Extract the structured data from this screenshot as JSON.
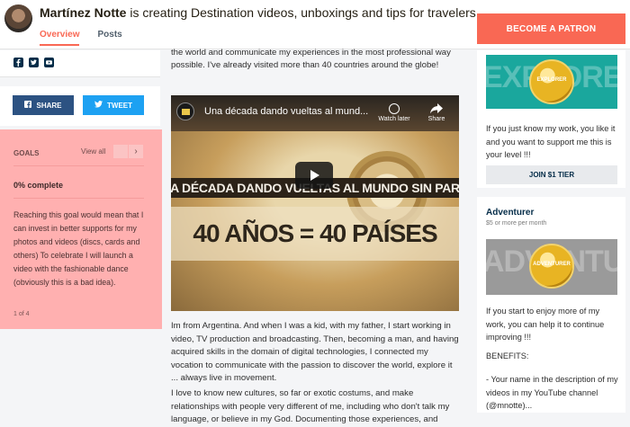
{
  "header": {
    "creator_name": "Martínez Notte",
    "tagline": " is creating Destination videos, unboxings and tips for travelers.",
    "tabs": [
      {
        "label": "Overview",
        "active": true
      },
      {
        "label": "Posts",
        "active": false
      }
    ],
    "become_patron_label": "BECOME A PATRON",
    "accent_color": "#f96854"
  },
  "social": {
    "icons": [
      "facebook-icon",
      "twitter-icon",
      "youtube-icon"
    ],
    "share_label": "SHARE",
    "tweet_label": "TWEET"
  },
  "goals": {
    "title": "GOALS",
    "view_all": "View all",
    "next_glyph": "›",
    "complete": "0% complete",
    "description": "Reaching this goal would mean that I can invest in better supports for my photos and videos (discs, cards and others) To celebrate I will launch a video with the fashionable dance (obviously this is a bad idea).",
    "pagination": "1 of 4"
  },
  "about": {
    "intro": "the world and communicate my experiences in the most professional way possible. I've already visited more than 40 countries around the globe!",
    "video": {
      "title": "Una década dando vueltas al mund...",
      "watch_later": "Watch later",
      "share": "Share",
      "banner_line1": "UNA DÉCADA DANDO VUELTAS AL MUNDO SIN PARAR",
      "banner_line2": "40 AÑOS = 40 PAÍSES"
    },
    "paragraph1": "Im from Argentina. And when I was a kid, with my father, I start working in video, TV production and broadcasting. Then, becoming a man, and having acquired skills in the domain of digital technologies, I connected my vocation to communicate with the passion to discover the world, explore it ... always live in movement.",
    "paragraph2": "I love to know new cultures, so far or exotic costums, and make relationships with people very different of me, including who don't talk my language, or believe in my God. Documenting those experiences, and"
  },
  "tiers": [
    {
      "image_text": "EXPLORER",
      "medal_text": "EXPLORER",
      "description": "If you just know my work, you like it and you want to support me this is your level !!!",
      "join_label": "JOIN $1 TIER"
    },
    {
      "name": "Adventurer",
      "price": "$5 or more per month",
      "image_text": "ADVENTURER",
      "medal_text": "ADVENTURER",
      "description": "If you start to enjoy more of my work, you can help it to continue improving !!!",
      "benefits_title": "BENEFITS:",
      "benefits_text": "- Your name in the description of my videos in my YouTube channel (@mnotte)..."
    }
  ]
}
